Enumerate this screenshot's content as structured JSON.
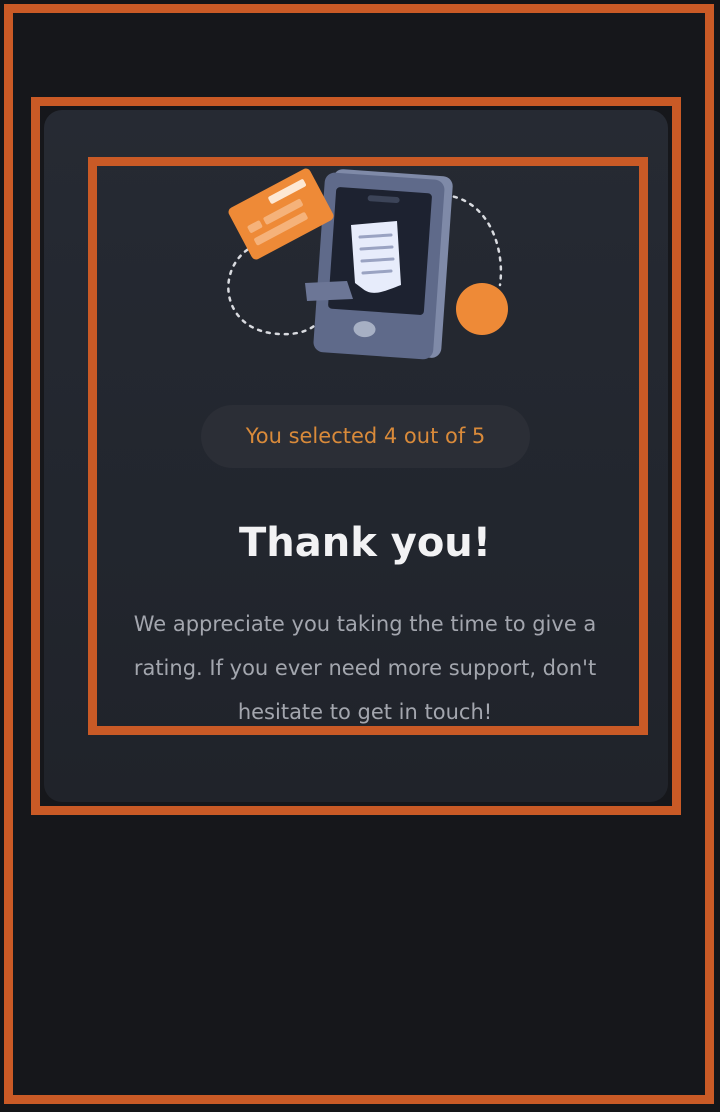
{
  "rating": {
    "selected_text": "You selected 4 out of 5"
  },
  "message": {
    "title": "Thank you!",
    "body": "We appreciate you taking the time to give a rating. If you ever need more support, don't hesitate to get in touch!"
  },
  "illustration": {
    "icon": "phone-receipt-card-icon",
    "accent_color": "#ee8a37",
    "phone_color": "#5c6786"
  },
  "colors": {
    "frame": "#c95a26",
    "card": "#252831",
    "pill_text": "#d98a3a"
  }
}
